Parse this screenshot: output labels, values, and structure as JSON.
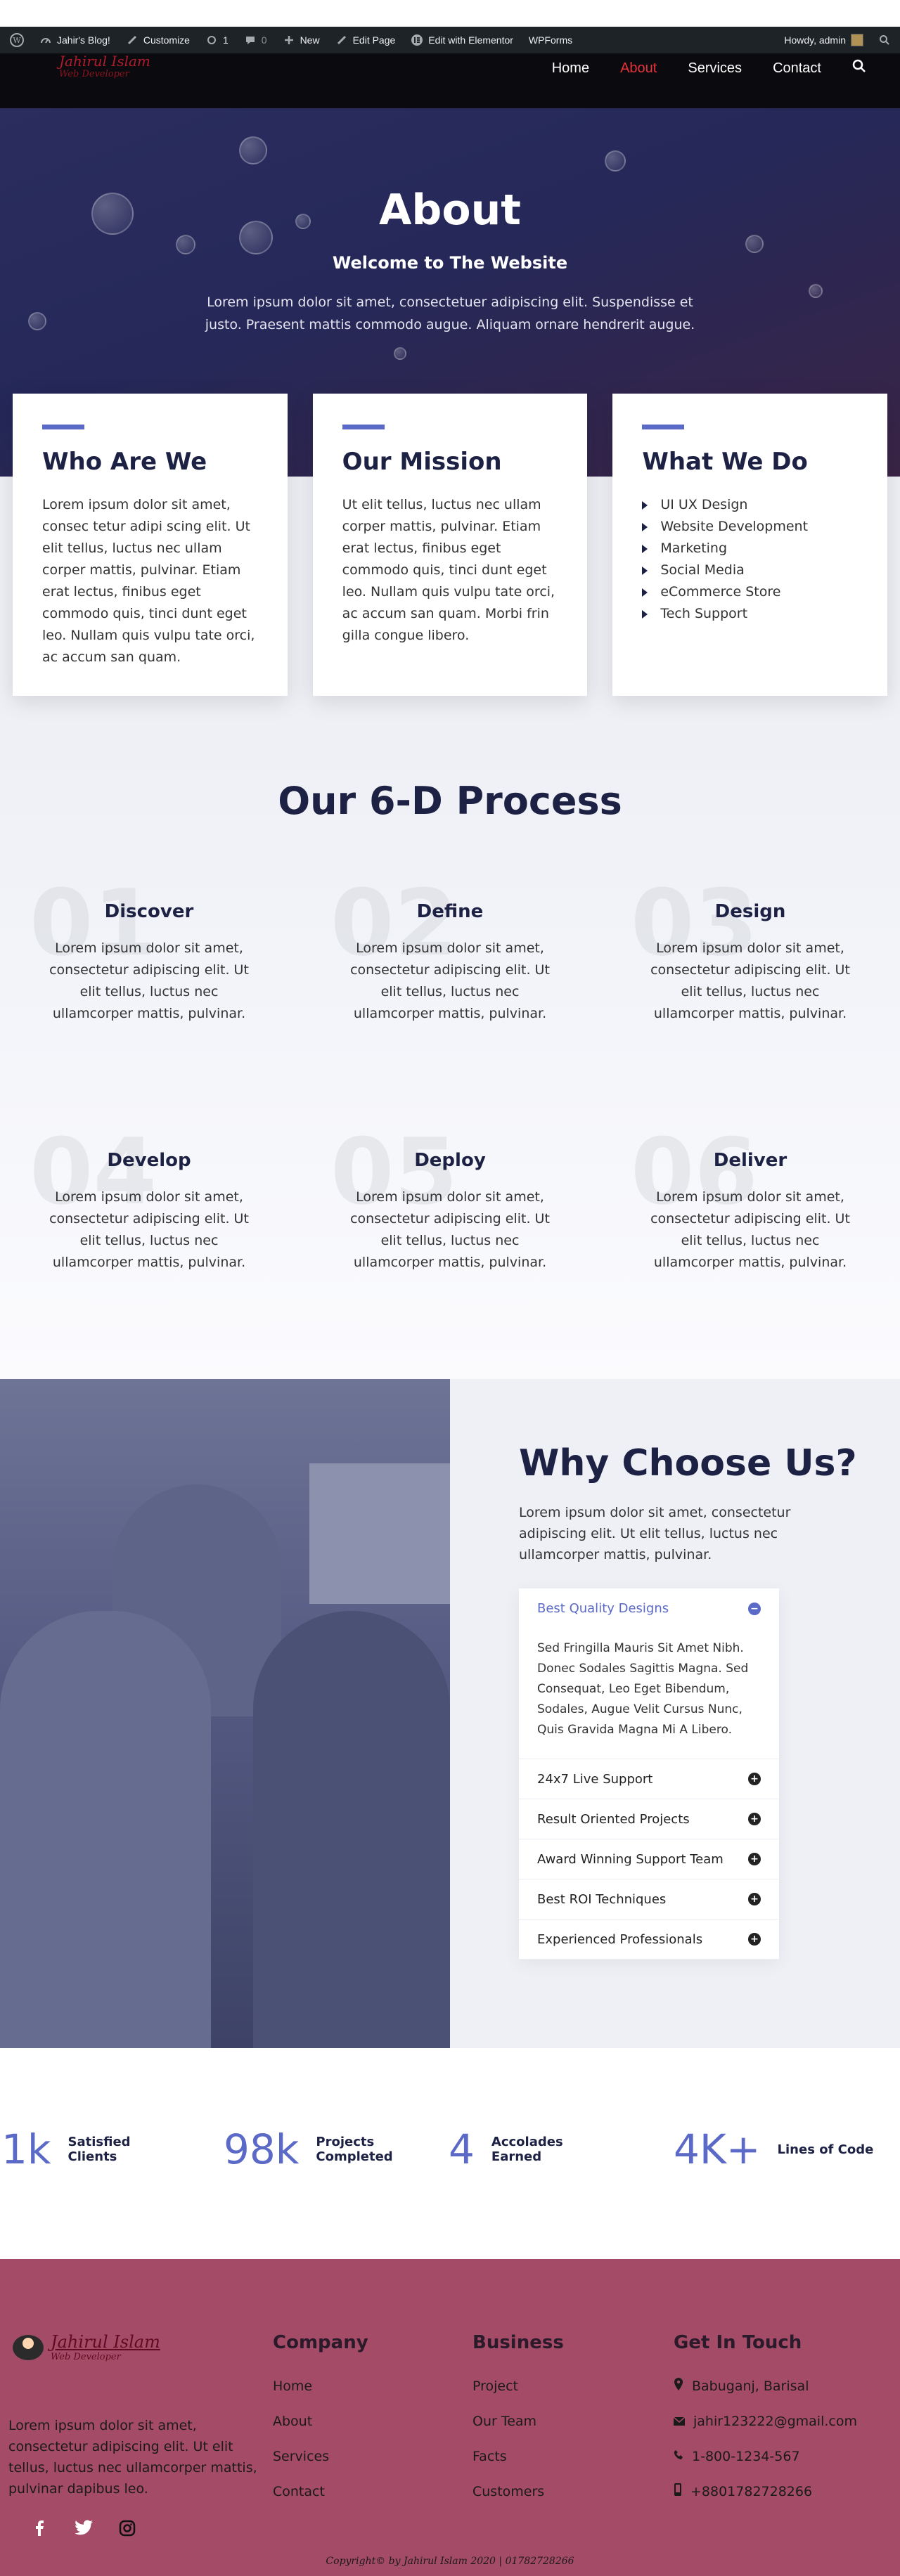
{
  "adminbar": {
    "site": "Jahir's Blog!",
    "customize": "Customize",
    "updates": "1",
    "comments": "0",
    "new": "New",
    "edit_page": "Edit Page",
    "elementor": "Edit with Elementor",
    "wpforms": "WPForms",
    "howdy": "Howdy, admin"
  },
  "header": {
    "logo_line1": "Jahirul Islam",
    "logo_line2": "Web Developer",
    "nav": [
      "Home",
      "About",
      "Services",
      "Contact"
    ],
    "active": "About"
  },
  "hero": {
    "title": "About",
    "subtitle": "Welcome to The Website",
    "text": "Lorem ipsum dolor sit amet, consectetuer adipiscing elit. Suspendisse et justo. Praesent mattis commodo augue. Aliquam ornare hendrerit augue."
  },
  "cards": [
    {
      "title": "Who Are We",
      "text": "Lorem ipsum dolor sit amet, consec tetur adipi scing elit. Ut elit tellus, luctus nec ullam corper mattis, pulvinar. Etiam erat lectus, finibus eget commodo quis, tinci dunt eget leo. Nullam quis vulpu tate orci, ac accum san quam."
    },
    {
      "title": "Our Mission",
      "text": "Ut elit tellus, luctus nec ullam corper mattis, pulvinar. Etiam erat lectus, finibus eget commodo quis, tinci dunt eget leo. Nullam quis vulpu tate orci, ac accum san quam. Morbi frin gilla congue libero."
    },
    {
      "title": "What We Do",
      "items": [
        "UI UX Design",
        "Website Development",
        "Marketing",
        "Social Media",
        "eCommerce Store",
        "Tech Support"
      ]
    }
  ],
  "process": {
    "title": "Our 6-D Process",
    "steps": [
      {
        "num": "01",
        "title": "Discover",
        "text": "Lorem ipsum dolor sit amet, consectetur adipiscing elit. Ut elit tellus, luctus nec ullamcorper mattis, pulvinar."
      },
      {
        "num": "02",
        "title": "Define",
        "text": "Lorem ipsum dolor sit amet, consectetur adipiscing elit. Ut elit tellus, luctus nec ullamcorper mattis, pulvinar."
      },
      {
        "num": "03",
        "title": "Design",
        "text": "Lorem ipsum dolor sit amet, consectetur adipiscing elit. Ut elit tellus, luctus nec ullamcorper mattis, pulvinar."
      },
      {
        "num": "04",
        "title": "Develop",
        "text": "Lorem ipsum dolor sit amet, consectetur adipiscing elit. Ut elit tellus, luctus nec ullamcorper mattis, pulvinar."
      },
      {
        "num": "05",
        "title": "Deploy",
        "text": "Lorem ipsum dolor sit amet, consectetur adipiscing elit. Ut elit tellus, luctus nec ullamcorper mattis, pulvinar."
      },
      {
        "num": "06",
        "title": "Deliver",
        "text": "Lorem ipsum dolor sit amet, consectetur adipiscing elit. Ut elit tellus, luctus nec ullamcorper mattis, pulvinar."
      }
    ]
  },
  "why": {
    "title": "Why Choose Us?",
    "intro": "Lorem ipsum dolor sit amet, consectetur adipiscing elit. Ut elit tellus, luctus nec ullamcorper mattis, pulvinar.",
    "open_item": "Best Quality Designs",
    "open_text": "Sed Fringilla Mauris Sit Amet Nibh. Donec Sodales Sagittis Magna. Sed Consequat, Leo Eget Bibendum, Sodales, Augue Velit Cursus Nunc, Quis Gravida Magna Mi A Libero.",
    "items": [
      "24x7 Live Support",
      "Result Oriented Projects",
      "Award Winning Support Team",
      "Best ROI Techniques",
      "Experienced Professionals"
    ]
  },
  "stats": [
    {
      "value": "1k",
      "label": "Satisfied Clients"
    },
    {
      "value": "98k",
      "label": "Projects Completed"
    },
    {
      "value": "4",
      "label": "Accolades Earned"
    },
    {
      "value": "4K+",
      "label": "Lines of Code"
    }
  ],
  "footer": {
    "logo_line1": "Jahirul Islam",
    "logo_line2": "Web Developer",
    "about": "Lorem ipsum dolor sit amet, consectetur adipiscing elit. Ut elit tellus, luctus nec ullamcorper mattis, pulvinar dapibus leo.",
    "company_title": "Company",
    "company": [
      "Home",
      "About",
      "Services",
      "Contact"
    ],
    "business_title": "Business",
    "business": [
      "Project",
      "Our Team",
      "Facts",
      "Customers"
    ],
    "contact_title": "Get In Touch",
    "contact": [
      "Babuganj, Barisal",
      "jahir123222@gmail.com",
      "1-800-1234-567",
      "+8801782728266"
    ],
    "copyright": "Copyright© by Jahirul Islam 2020 | 01782728266"
  },
  "colors": {
    "accent": "#5b69c7",
    "navy": "#1d2245",
    "footer": "#a44b68",
    "nav_active": "#e8323b"
  }
}
